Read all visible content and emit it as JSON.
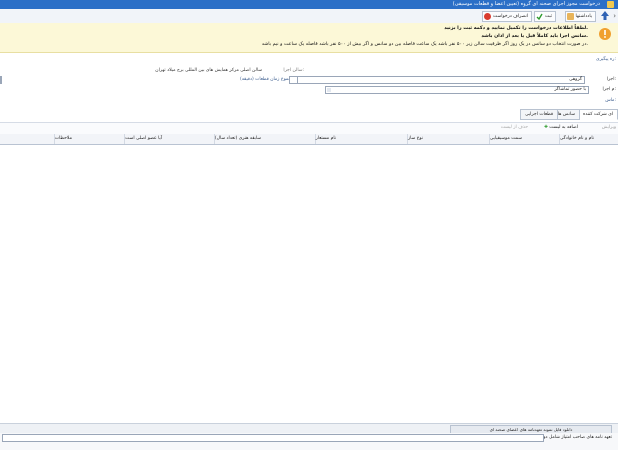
{
  "window": {
    "title": "درخواست مجوز اجرای صحنه ای گروه (تعیین اعضا و قطعات موسیقی)"
  },
  "toolbar": {
    "confirm_label": "ثبت",
    "cancel_label": "انصراف درخواست",
    "note_label": "یادداشتها"
  },
  "notice": {
    "line1": "لطفاً اطلاعات درخواست را تکمیل نمایید و دکمه ثبت را بزنید.",
    "line2": "سانس اجرا باید کاملاً قبل یا بعد از اذان باشد.",
    "line3": "در صورت انتخاب دو سانس در یک روز اگر ظرفیت سالن زیر ۵۰۰ نفر باشد یک ساعت فاصله بین دو سانس و اگر بیش از ۵۰۰ نفر باشد فاصله یک ساعت و نیم باشد."
  },
  "form": {
    "section_label": "ره پیگیری:",
    "venue_label": "سالن اجرا:",
    "venue_value": "سالن اصلی مرکز همایش های بین المللی برج میلاد تهران",
    "group_label": "اجرا:",
    "group_value": "گروهی",
    "duration_label": "مجموع زمان قطعات (دقیقه)",
    "exec_label": "م اجرا:",
    "exec_value": "با حضور تماشاگر",
    "extra_label": "ماس:"
  },
  "tabs": [
    {
      "label": "ای شرکت کننده"
    },
    {
      "label": "سانس ها"
    },
    {
      "label": "قطعات اجرایی"
    }
  ],
  "subbar": {
    "edit_label": "ویرایش",
    "add_label": "اضافه به لیست",
    "delete_label": "حذف از لیست"
  },
  "table": {
    "headers": [
      "نام و نام خانوادگی",
      "سمت موسیقیایی",
      "نوع ساز",
      "نام مستعار",
      "سابقه هنری (تعداد سال)",
      "آیا عضو اصلی است",
      "ملاحظات"
    ]
  },
  "footer": {
    "download_label": "دانلود فایل نمونه تعهدنامه های اعضای صحنه ای",
    "question": "تعهد نامه های صاحب امتیاز شامل دو فرم؟"
  }
}
